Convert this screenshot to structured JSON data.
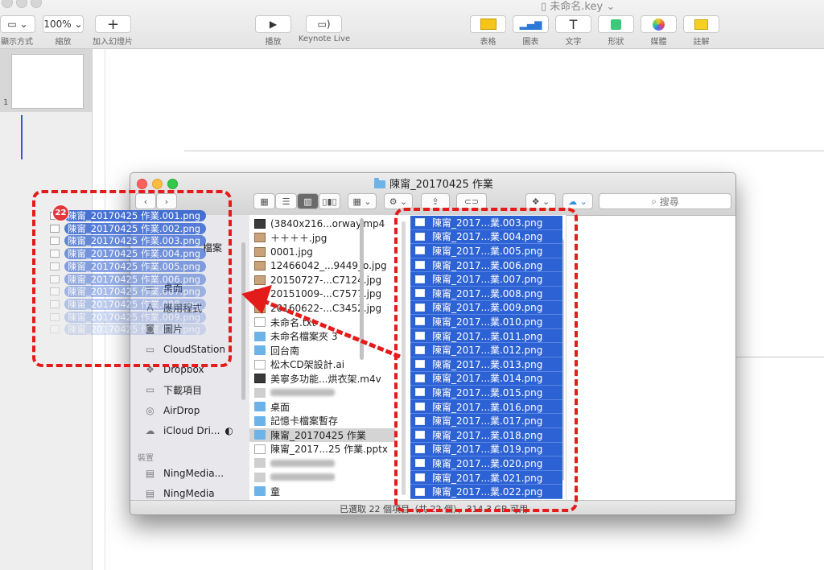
{
  "keynote": {
    "document_title": "未命名.key",
    "toolbar": {
      "view_label": "顯示方式",
      "zoom_value": "100%",
      "zoom_label": "縮放",
      "add_slide_label": "加入幻燈片",
      "play_label": "播放",
      "keynote_live_label": "Keynote Live",
      "table_label": "表格",
      "chart_label": "圖表",
      "text_label": "文字",
      "shape_label": "形狀",
      "media_label": "媒體",
      "comment_label": "註解"
    },
    "navigator": {
      "slide_number": "1"
    }
  },
  "finder": {
    "title": "陳甯_20170425 作業",
    "search_placeholder": "搜尋",
    "sidebar": {
      "favorites_partial": "檔案",
      "items": [
        {
          "label": "桌面",
          "icon": "desktop-icon"
        },
        {
          "label": "應用程式",
          "icon": "applications-icon"
        },
        {
          "label": "圖片",
          "icon": "camera-icon"
        },
        {
          "label": "CloudStation",
          "icon": "folder-icon"
        },
        {
          "label": "Dropbox",
          "icon": "dropbox-icon"
        },
        {
          "label": "下載項目",
          "icon": "folder-icon"
        },
        {
          "label": "AirDrop",
          "icon": "airdrop-icon"
        },
        {
          "label": "iCloud Dri...",
          "icon": "cloud-icon"
        }
      ],
      "devices_header": "裝置",
      "devices": [
        {
          "label": "NingMedia...",
          "icon": "drive-icon"
        },
        {
          "label": "NingMedia",
          "icon": "drive-icon"
        }
      ]
    },
    "column1": [
      {
        "name": "(3840x216...orway.mp4",
        "kind": "video"
      },
      {
        "name": "＋＋＋＋.jpg",
        "kind": "image"
      },
      {
        "name": "0001.jpg",
        "kind": "image"
      },
      {
        "name": "12466042_...9449_o.jpg",
        "kind": "image"
      },
      {
        "name": "20150727-...C7124.jpg",
        "kind": "image"
      },
      {
        "name": "20151009-...C7577.jpg",
        "kind": "image"
      },
      {
        "name": "20160622-...C3452.jpg",
        "kind": "image"
      },
      {
        "name": "未命名.txt",
        "kind": "doc"
      },
      {
        "name": "未命名檔案夾 3",
        "kind": "folder"
      },
      {
        "name": "回台南",
        "kind": "folder"
      },
      {
        "name": "松木CD架設計.ai",
        "kind": "doc"
      },
      {
        "name": "美寧多功能...烘衣架.m4v",
        "kind": "video"
      },
      {
        "name": "",
        "kind": "blurred"
      },
      {
        "name": "桌面",
        "kind": "folder"
      },
      {
        "name": "記憶卡檔案暫存",
        "kind": "folder"
      },
      {
        "name": "陳甯_20170425 作業",
        "kind": "folder-selected"
      },
      {
        "name": "陳甯_2017...25 作業.pptx",
        "kind": "doc"
      },
      {
        "name": "",
        "kind": "blurred"
      },
      {
        "name": "",
        "kind": "blurred"
      },
      {
        "name": "童",
        "kind": "folder"
      }
    ],
    "column2": [
      "陳甯_2017...業.003.png",
      "陳甯_2017...業.004.png",
      "陳甯_2017...業.005.png",
      "陳甯_2017...業.006.png",
      "陳甯_2017...業.007.png",
      "陳甯_2017...業.008.png",
      "陳甯_2017...業.009.png",
      "陳甯_2017...業.010.png",
      "陳甯_2017...業.011.png",
      "陳甯_2017...業.012.png",
      "陳甯_2017...業.013.png",
      "陳甯_2017...業.014.png",
      "陳甯_2017...業.015.png",
      "陳甯_2017...業.016.png",
      "陳甯_2017...業.017.png",
      "陳甯_2017...業.018.png",
      "陳甯_2017...業.019.png",
      "陳甯_2017...業.020.png",
      "陳甯_2017...業.021.png",
      "陳甯_2017...業.022.png"
    ],
    "status": "已選取 22 個項目（共 22 個），314.3 GB 可用"
  },
  "drag_preview": {
    "count": "22",
    "items": [
      "陳甯_20170425 作業.001.png",
      "陳甯_20170425 作業.002.png",
      "陳甯_20170425 作業.003.png",
      "陳甯_20170425 作業.004.png",
      "陳甯_20170425 作業.005.png",
      "陳甯_20170425 作業.006.png",
      "陳甯_20170425 作業.007.png",
      "陳甯_20170425 作業.008.png",
      "陳甯_20170425 作業.009.png",
      "陳甯_20170425 作業.010.png"
    ]
  },
  "annotation_color": "#e31b1b",
  "selection_color": "#2d62d4"
}
